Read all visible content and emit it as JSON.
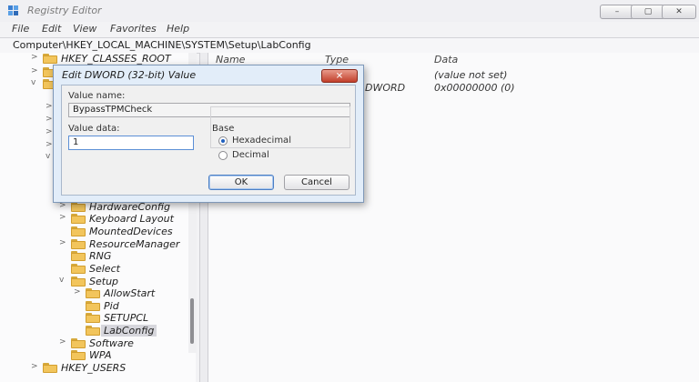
{
  "window": {
    "title": "Registry Editor",
    "controls": [
      "–",
      "▢",
      "✕"
    ]
  },
  "menu": [
    "File",
    "Edit",
    "View",
    "Favorites",
    "Help"
  ],
  "address": "Computer\\HKEY_LOCAL_MACHINE\\SYSTEM\\Setup\\LabConfig",
  "tree": {
    "top": [
      {
        "label": "HKEY_CLASSES_ROOT",
        "chev": ">"
      }
    ],
    "visible": [
      {
        "label": "HardwareConfig",
        "chev": ">"
      },
      {
        "label": "Keyboard Layout",
        "chev": ">"
      },
      {
        "label": "MountedDevices",
        "chev": ""
      },
      {
        "label": "ResourceManager",
        "chev": ">"
      },
      {
        "label": "RNG",
        "chev": ""
      },
      {
        "label": "Select",
        "chev": ""
      },
      {
        "label": "Setup",
        "chev": "v"
      },
      {
        "label": "AllowStart",
        "chev": ">"
      },
      {
        "label": "Pid",
        "chev": ""
      },
      {
        "label": "SETUPCL",
        "chev": ""
      },
      {
        "label": "LabConfig",
        "chev": ""
      },
      {
        "label": "Software",
        "chev": ">"
      },
      {
        "label": "WPA",
        "chev": ""
      },
      {
        "label": "HKEY_USERS",
        "chev": ">"
      }
    ]
  },
  "list": {
    "columns": [
      "Name",
      "Type",
      "Data"
    ],
    "rows": [
      {
        "type_fragment": "",
        "data": "(value not set)"
      },
      {
        "type_fragment": "DWORD",
        "data": "0x00000000 (0)"
      }
    ]
  },
  "dialog": {
    "title": "Edit DWORD (32-bit) Value",
    "close": "✕",
    "value_name_label": "Value name:",
    "value_name": "BypassTPMCheck",
    "value_data_label": "Value data:",
    "value_data": "1",
    "base_label": "Base",
    "base_options": [
      "Hexadecimal",
      "Decimal"
    ],
    "base_selected": "Hexadecimal",
    "ok_label": "OK",
    "cancel_label": "Cancel"
  }
}
